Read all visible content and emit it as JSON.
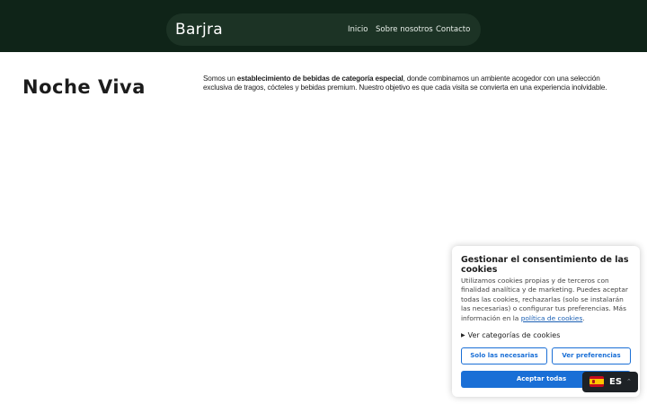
{
  "header": {
    "brand": "Barjra",
    "nav": [
      "Inicio",
      "Sobre nosotros",
      "Contacto"
    ],
    "background_color": "#0f2418"
  },
  "hero": {
    "title": "Noche Viva",
    "intro_before": "Somos un ",
    "intro_bold": "establecimiento de bebidas de categoría especial",
    "intro_after": ", donde combinamos un ambiente acogedor con una selección exclusiva de tragos, cócteles y bebidas premium. Nuestro objetivo es que cada visita se convierta en una experiencia inolvidable."
  },
  "cookie_banner": {
    "title": "Gestionar el consentimiento de las cookies",
    "body_before": "Utilizamos cookies propias y de terceros con finalidad analítica y de marketing. Puedes aceptar todas las cookies, rechazarlas (solo se instalarán las necesarias) o configurar tus preferencias. Más información en la ",
    "policy_link": "política de cookies",
    "body_after": ".",
    "categories_toggle": "Ver categorías de cookies",
    "btn_necessary": "Solo las necesarias",
    "btn_preferences": "Ver preferencias",
    "btn_accept": "Aceptar todas",
    "accent_color": "#1a6fd6"
  },
  "language_switcher": {
    "code": "ES",
    "flag_icon": "spain-flag-icon"
  }
}
